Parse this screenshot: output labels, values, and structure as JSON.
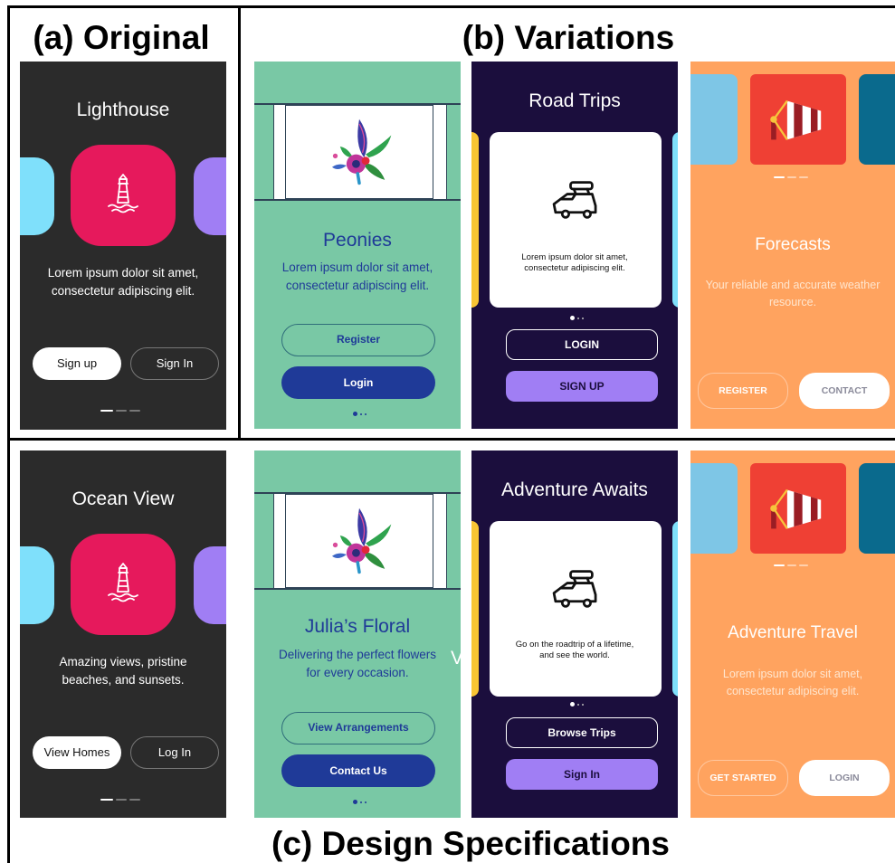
{
  "captions": {
    "original": "(a) Original",
    "variations": "(b) Variations",
    "specs": "(c) Design Specifications"
  },
  "colors": {
    "dark_bg": "#2b2b2b",
    "pink": "#e6195c",
    "cyan": "#7fe0fb",
    "purple": "#a07ef4",
    "mint": "#79c8a5",
    "royal_blue": "#1f3a98",
    "navy": "#1b0e3d",
    "yellow": "#f8c534",
    "orange": "#ffa35f",
    "red": "#ef4034",
    "teal": "#0a6a8d"
  },
  "original": {
    "title": "Lighthouse",
    "icon": "lighthouse-icon",
    "body": "Lorem ipsum dolor sit amet, consectetur adipiscing elit.",
    "primary": "Sign up",
    "secondary": "Sign In"
  },
  "variations": {
    "green": {
      "illustration": "flower-illustration",
      "title": "Peonies",
      "body": "Lorem ipsum dolor sit amet, consectetur adipiscing elit.",
      "outline": "Register",
      "filled": "Login"
    },
    "navy": {
      "title": "Road Trips",
      "icon": "car-icon",
      "body": "Lorem ipsum dolor sit amet, consectetur adipiscing elit.",
      "outline": "LOGIN",
      "filled": "SIGN UP"
    },
    "orange": {
      "icon": "windsock-icon",
      "title": "Forecasts",
      "body": "Your reliable and accurate weather resource.",
      "outline": "REGISTER",
      "filled": "CONTACT"
    }
  },
  "specs": {
    "dark": {
      "title": "Ocean View",
      "icon": "lighthouse-icon",
      "body": "Amazing views, pristine beaches, and sunsets.",
      "primary": "View Homes",
      "secondary": "Log In"
    },
    "green": {
      "illustration": "flower-illustration",
      "title": "Julia’s Floral",
      "body": "Delivering the perfect flowers for every occasion.",
      "outline": "View Arrangements",
      "filled": "Contact Us",
      "ghost": "V"
    },
    "navy": {
      "title": "Adventure Awaits",
      "icon": "car-icon",
      "body": "Go on the roadtrip of a lifetime, and see the world.",
      "outline": "Browse Trips",
      "filled": "Sign In"
    },
    "orange": {
      "icon": "windsock-icon",
      "title": "Adventure Travel",
      "body": "Lorem ipsum dolor sit amet, consectetur adipiscing elit.",
      "outline": "GET STARTED",
      "filled": "LOGIN"
    }
  }
}
